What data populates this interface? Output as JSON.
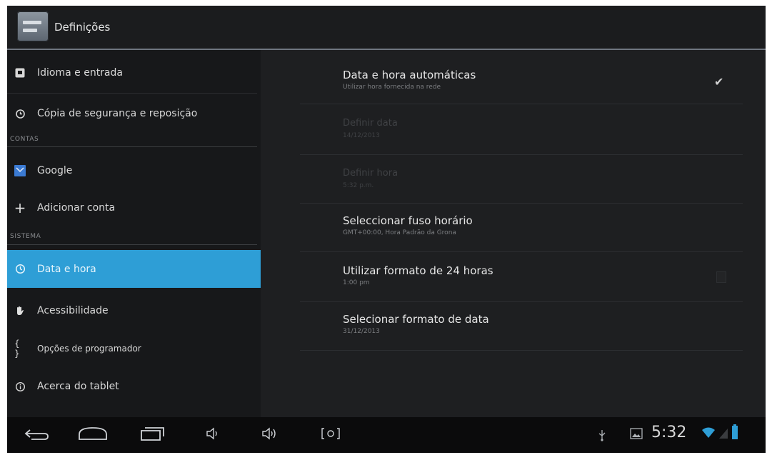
{
  "app": {
    "title": "Definições"
  },
  "sidebar": {
    "items": [
      {
        "label": "Idioma e entrada",
        "icon": "keyboard-icon"
      },
      {
        "label": "Cópia de segurança e reposição",
        "icon": "backup-icon"
      },
      {
        "label": "Google",
        "icon": "google-icon"
      },
      {
        "label": "Adicionar conta",
        "icon": "add-icon"
      },
      {
        "label": "Data e hora",
        "icon": "clock-icon",
        "active": true
      },
      {
        "label": "Acessibilidade",
        "icon": "hand-icon"
      },
      {
        "label": "Opções de programador",
        "icon": "braces-icon"
      },
      {
        "label": "Acerca do tablet",
        "icon": "info-icon"
      }
    ],
    "sections": {
      "contas": "CONTAS",
      "sistema": "SISTEMA"
    }
  },
  "settings": [
    {
      "title": "Data e hora automáticas",
      "subtitle": "Utilizar hora fornecida na rede",
      "checked": true
    },
    {
      "title": "Definir data",
      "subtitle": "14/12/2013",
      "enabled": false
    },
    {
      "title": "Definir hora",
      "subtitle": "5:32 p.m.",
      "enabled": false
    },
    {
      "title": "Seleccionar fuso horário",
      "subtitle": "GMT+00:00, Hora Padrão da Grona"
    },
    {
      "title": "Utilizar formato de 24 horas",
      "subtitle": "1:00 pm",
      "checked": false
    },
    {
      "title": "Selecionar formato de data",
      "subtitle": "31/12/2013"
    }
  ],
  "status": {
    "time": "5:32"
  },
  "colors": {
    "accent": "#2e9ed6",
    "background": "#1e1f21",
    "sidebar": "#17181a"
  }
}
